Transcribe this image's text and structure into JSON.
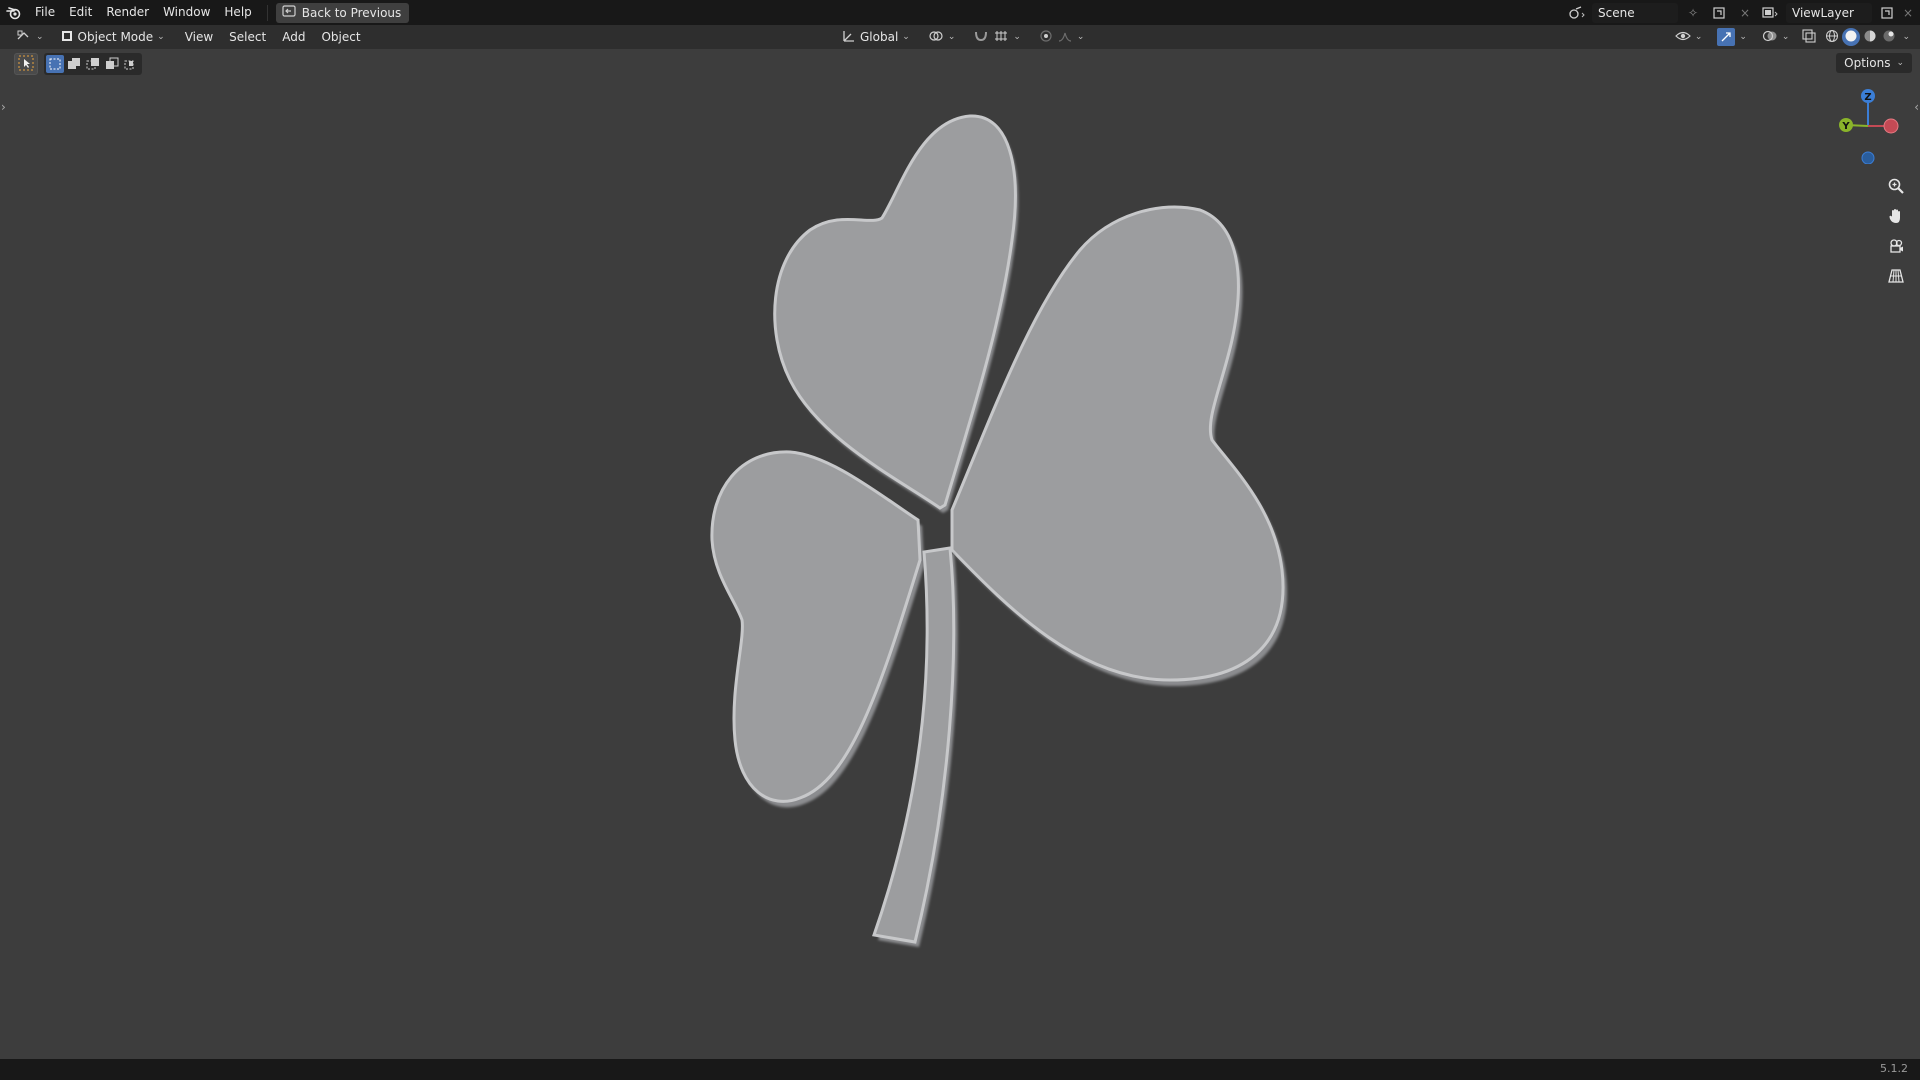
{
  "menu": {
    "items": [
      "File",
      "Edit",
      "Render",
      "Window",
      "Help"
    ],
    "back_button": "Back to Previous"
  },
  "top_right": {
    "scene": "Scene",
    "view_layer": "ViewLayer"
  },
  "viewport_header": {
    "mode": "Object Mode",
    "menus": [
      "View",
      "Select",
      "Add",
      "Object"
    ],
    "orientation": "Global"
  },
  "options_label": "Options",
  "gizmo": {
    "z": "Z",
    "y": "Y"
  },
  "status": {
    "version": "5.1.2"
  },
  "colors": {
    "accent": "#4772b3",
    "axis_x": "#c44a55",
    "axis_y": "#8ab42a",
    "axis_z": "#3b7ed6",
    "object": "#9c9d9f"
  },
  "icons": [
    "blender-logo-icon",
    "back-icon",
    "editor-type-icon",
    "object-mode-icon",
    "orientation-icon",
    "pivot-icon",
    "snap-icon",
    "proportional-icon",
    "visibility-icon",
    "gizmo-icon",
    "overlay-icon",
    "xray-icon",
    "wireframe-icon",
    "solid-icon",
    "material-icon",
    "rendered-icon",
    "zoom-icon",
    "hand-icon",
    "camera-icon",
    "grid-icon"
  ]
}
